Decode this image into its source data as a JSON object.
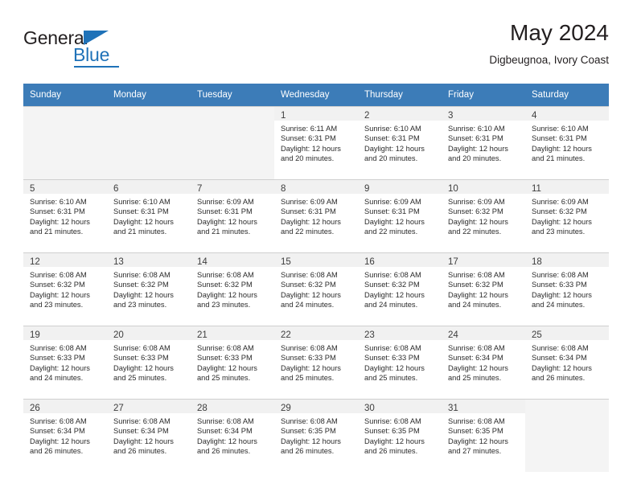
{
  "brand": {
    "name_top": "General",
    "name_bottom": "Blue",
    "accent_color": "#1f72b8"
  },
  "header": {
    "title": "May 2024",
    "subtitle": "Digbeugnoa, Ivory Coast"
  },
  "theme": {
    "header_row_bg": "#3c7cb8",
    "header_row_text": "#ffffff",
    "daynum_band_bg": "#f1f1f1",
    "empty_cell_bg": "#f4f4f4",
    "grid_line": "#cfcfcf"
  },
  "calendar": {
    "weekday_headers": [
      "Sunday",
      "Monday",
      "Tuesday",
      "Wednesday",
      "Thursday",
      "Friday",
      "Saturday"
    ],
    "weeks": [
      [
        {
          "day": "",
          "lines": []
        },
        {
          "day": "",
          "lines": []
        },
        {
          "day": "",
          "lines": []
        },
        {
          "day": "1",
          "lines": [
            "Sunrise: 6:11 AM",
            "Sunset: 6:31 PM",
            "Daylight: 12 hours",
            "and 20 minutes."
          ]
        },
        {
          "day": "2",
          "lines": [
            "Sunrise: 6:10 AM",
            "Sunset: 6:31 PM",
            "Daylight: 12 hours",
            "and 20 minutes."
          ]
        },
        {
          "day": "3",
          "lines": [
            "Sunrise: 6:10 AM",
            "Sunset: 6:31 PM",
            "Daylight: 12 hours",
            "and 20 minutes."
          ]
        },
        {
          "day": "4",
          "lines": [
            "Sunrise: 6:10 AM",
            "Sunset: 6:31 PM",
            "Daylight: 12 hours",
            "and 21 minutes."
          ]
        }
      ],
      [
        {
          "day": "5",
          "lines": [
            "Sunrise: 6:10 AM",
            "Sunset: 6:31 PM",
            "Daylight: 12 hours",
            "and 21 minutes."
          ]
        },
        {
          "day": "6",
          "lines": [
            "Sunrise: 6:10 AM",
            "Sunset: 6:31 PM",
            "Daylight: 12 hours",
            "and 21 minutes."
          ]
        },
        {
          "day": "7",
          "lines": [
            "Sunrise: 6:09 AM",
            "Sunset: 6:31 PM",
            "Daylight: 12 hours",
            "and 21 minutes."
          ]
        },
        {
          "day": "8",
          "lines": [
            "Sunrise: 6:09 AM",
            "Sunset: 6:31 PM",
            "Daylight: 12 hours",
            "and 22 minutes."
          ]
        },
        {
          "day": "9",
          "lines": [
            "Sunrise: 6:09 AM",
            "Sunset: 6:31 PM",
            "Daylight: 12 hours",
            "and 22 minutes."
          ]
        },
        {
          "day": "10",
          "lines": [
            "Sunrise: 6:09 AM",
            "Sunset: 6:32 PM",
            "Daylight: 12 hours",
            "and 22 minutes."
          ]
        },
        {
          "day": "11",
          "lines": [
            "Sunrise: 6:09 AM",
            "Sunset: 6:32 PM",
            "Daylight: 12 hours",
            "and 23 minutes."
          ]
        }
      ],
      [
        {
          "day": "12",
          "lines": [
            "Sunrise: 6:08 AM",
            "Sunset: 6:32 PM",
            "Daylight: 12 hours",
            "and 23 minutes."
          ]
        },
        {
          "day": "13",
          "lines": [
            "Sunrise: 6:08 AM",
            "Sunset: 6:32 PM",
            "Daylight: 12 hours",
            "and 23 minutes."
          ]
        },
        {
          "day": "14",
          "lines": [
            "Sunrise: 6:08 AM",
            "Sunset: 6:32 PM",
            "Daylight: 12 hours",
            "and 23 minutes."
          ]
        },
        {
          "day": "15",
          "lines": [
            "Sunrise: 6:08 AM",
            "Sunset: 6:32 PM",
            "Daylight: 12 hours",
            "and 24 minutes."
          ]
        },
        {
          "day": "16",
          "lines": [
            "Sunrise: 6:08 AM",
            "Sunset: 6:32 PM",
            "Daylight: 12 hours",
            "and 24 minutes."
          ]
        },
        {
          "day": "17",
          "lines": [
            "Sunrise: 6:08 AM",
            "Sunset: 6:32 PM",
            "Daylight: 12 hours",
            "and 24 minutes."
          ]
        },
        {
          "day": "18",
          "lines": [
            "Sunrise: 6:08 AM",
            "Sunset: 6:33 PM",
            "Daylight: 12 hours",
            "and 24 minutes."
          ]
        }
      ],
      [
        {
          "day": "19",
          "lines": [
            "Sunrise: 6:08 AM",
            "Sunset: 6:33 PM",
            "Daylight: 12 hours",
            "and 24 minutes."
          ]
        },
        {
          "day": "20",
          "lines": [
            "Sunrise: 6:08 AM",
            "Sunset: 6:33 PM",
            "Daylight: 12 hours",
            "and 25 minutes."
          ]
        },
        {
          "day": "21",
          "lines": [
            "Sunrise: 6:08 AM",
            "Sunset: 6:33 PM",
            "Daylight: 12 hours",
            "and 25 minutes."
          ]
        },
        {
          "day": "22",
          "lines": [
            "Sunrise: 6:08 AM",
            "Sunset: 6:33 PM",
            "Daylight: 12 hours",
            "and 25 minutes."
          ]
        },
        {
          "day": "23",
          "lines": [
            "Sunrise: 6:08 AM",
            "Sunset: 6:33 PM",
            "Daylight: 12 hours",
            "and 25 minutes."
          ]
        },
        {
          "day": "24",
          "lines": [
            "Sunrise: 6:08 AM",
            "Sunset: 6:34 PM",
            "Daylight: 12 hours",
            "and 25 minutes."
          ]
        },
        {
          "day": "25",
          "lines": [
            "Sunrise: 6:08 AM",
            "Sunset: 6:34 PM",
            "Daylight: 12 hours",
            "and 26 minutes."
          ]
        }
      ],
      [
        {
          "day": "26",
          "lines": [
            "Sunrise: 6:08 AM",
            "Sunset: 6:34 PM",
            "Daylight: 12 hours",
            "and 26 minutes."
          ]
        },
        {
          "day": "27",
          "lines": [
            "Sunrise: 6:08 AM",
            "Sunset: 6:34 PM",
            "Daylight: 12 hours",
            "and 26 minutes."
          ]
        },
        {
          "day": "28",
          "lines": [
            "Sunrise: 6:08 AM",
            "Sunset: 6:34 PM",
            "Daylight: 12 hours",
            "and 26 minutes."
          ]
        },
        {
          "day": "29",
          "lines": [
            "Sunrise: 6:08 AM",
            "Sunset: 6:35 PM",
            "Daylight: 12 hours",
            "and 26 minutes."
          ]
        },
        {
          "day": "30",
          "lines": [
            "Sunrise: 6:08 AM",
            "Sunset: 6:35 PM",
            "Daylight: 12 hours",
            "and 26 minutes."
          ]
        },
        {
          "day": "31",
          "lines": [
            "Sunrise: 6:08 AM",
            "Sunset: 6:35 PM",
            "Daylight: 12 hours",
            "and 27 minutes."
          ]
        },
        {
          "day": "",
          "lines": []
        }
      ]
    ]
  }
}
